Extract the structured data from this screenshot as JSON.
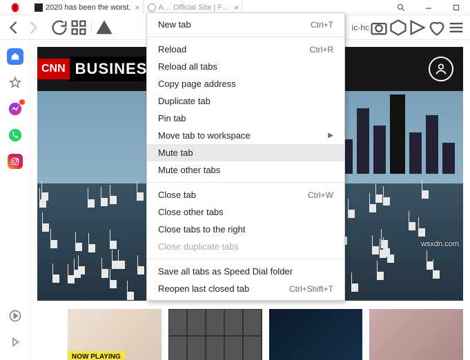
{
  "window": {
    "tab1_title": "2020 has been the worst.",
    "tab2_title": "A… Official Site | F…",
    "search_label": "Search",
    "minimize_label": "Minimize",
    "maximize_label": "Maximize"
  },
  "nav": {
    "url_fragment": "ic-hc"
  },
  "hero": {
    "cnn": "CNN",
    "business": "BUSINESS"
  },
  "thumbs": {
    "now_playing": "NOW PLAYING"
  },
  "context_menu": {
    "new_tab": "New tab",
    "new_tab_sc": "Ctrl+T",
    "reload": "Reload",
    "reload_sc": "Ctrl+R",
    "reload_all": "Reload all tabs",
    "copy_addr": "Copy page address",
    "duplicate": "Duplicate tab",
    "pin": "Pin tab",
    "move_ws": "Move tab to workspace",
    "mute": "Mute tab",
    "mute_other": "Mute other tabs",
    "close_tab": "Close tab",
    "close_tab_sc": "Ctrl+W",
    "close_other": "Close other tabs",
    "close_right": "Close tabs to the right",
    "close_dup": "Close duplicate tabs",
    "save_sd": "Save all tabs as Speed Dial folder",
    "reopen": "Reopen last closed tab",
    "reopen_sc": "Ctrl+Shift+T"
  },
  "watermark": "wsxdn.com"
}
